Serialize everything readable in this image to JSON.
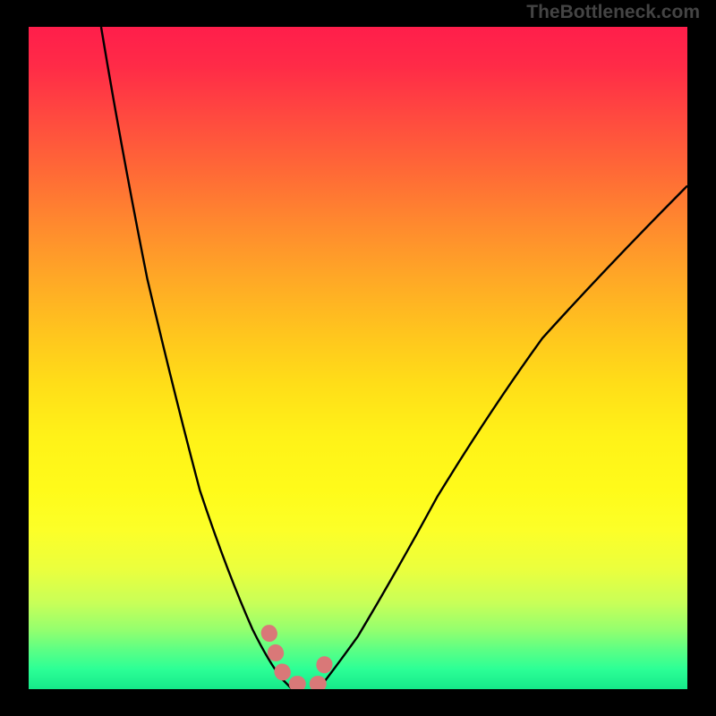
{
  "attribution": "TheBottleneck.com",
  "chart_data": {
    "type": "line",
    "title": "",
    "xlabel": "",
    "ylabel": "",
    "xlim": [
      0,
      100
    ],
    "ylim": [
      0,
      100
    ],
    "grid": false,
    "legend": false,
    "background": "gradient: red (top) → yellow (mid) → green (bottom)",
    "series": [
      {
        "name": "left-curve",
        "x": [
          11,
          14,
          18,
          22,
          26,
          30,
          34,
          36.5,
          38.5,
          40
        ],
        "values": [
          100,
          82,
          62,
          45,
          30,
          18,
          9,
          4,
          1.5,
          0
        ]
      },
      {
        "name": "right-curve",
        "x": [
          44,
          46,
          50,
          56,
          62,
          70,
          78,
          88,
          100
        ],
        "values": [
          0,
          2.5,
          8,
          18,
          29,
          42,
          53,
          64,
          76
        ]
      },
      {
        "name": "bottom-marker",
        "style": "salmon thick stroke",
        "x": [
          36.5,
          37.5,
          38,
          39,
          40,
          42,
          44,
          44.8,
          45.3
        ],
        "values": [
          8.5,
          5.5,
          3.5,
          1.8,
          0.8,
          0.8,
          0.8,
          3,
          6.5
        ]
      }
    ],
    "annotations": []
  },
  "colors": {
    "page_bg": "#000000",
    "attribution_text": "#444444",
    "curve": "#000000",
    "marker": "#d97878",
    "gradient_top": "#ff1e4b",
    "gradient_mid": "#fff218",
    "gradient_bottom": "#16e98a"
  }
}
